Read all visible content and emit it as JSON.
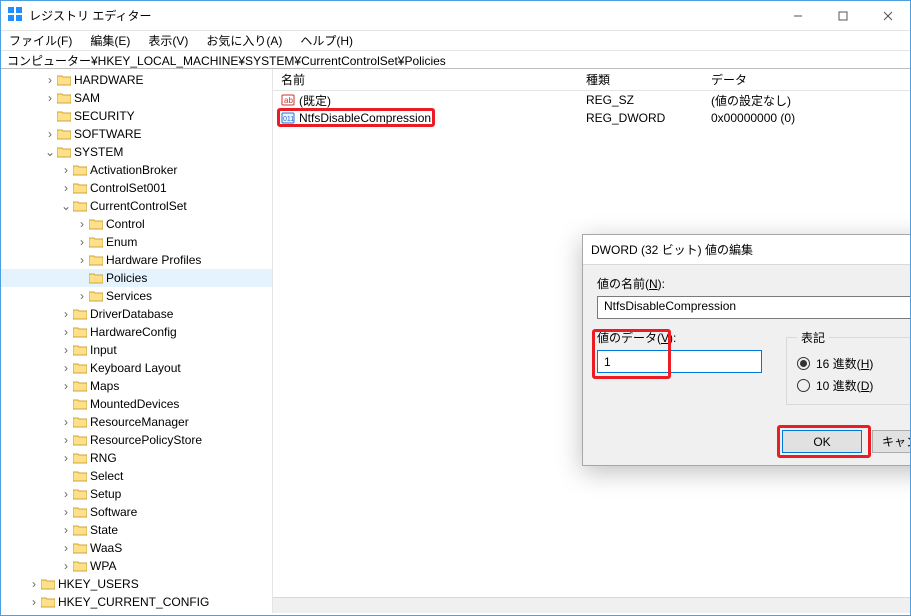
{
  "window": {
    "title": "レジストリ エディター"
  },
  "menu": {
    "file": "ファイル(F)",
    "edit": "編集(E)",
    "view": "表示(V)",
    "favorites": "お気に入り(A)",
    "help": "ヘルプ(H)"
  },
  "address": "コンピューター¥HKEY_LOCAL_MACHINE¥SYSTEM¥CurrentControlSet¥Policies",
  "tree": {
    "hardware": "HARDWARE",
    "sam": "SAM",
    "security": "SECURITY",
    "software": "SOFTWARE",
    "system": "SYSTEM",
    "activationbroker": "ActivationBroker",
    "controlset001": "ControlSet001",
    "currentcontrolset": "CurrentControlSet",
    "control": "Control",
    "enum": "Enum",
    "hardwareprofiles": "Hardware Profiles",
    "policies": "Policies",
    "services": "Services",
    "driverdatabase": "DriverDatabase",
    "hardwareconfig": "HardwareConfig",
    "input": "Input",
    "keyboardlayout": "Keyboard Layout",
    "maps": "Maps",
    "mounteddevices": "MountedDevices",
    "resourcemanager": "ResourceManager",
    "resourcepolicystore": "ResourcePolicyStore",
    "rng": "RNG",
    "select": "Select",
    "setup": "Setup",
    "softwarelc": "Software",
    "state": "State",
    "waas": "WaaS",
    "wpa": "WPA",
    "hkeyusers": "HKEY_USERS",
    "hkeycurrentconfig": "HKEY_CURRENT_CONFIG"
  },
  "columns": {
    "name": "名前",
    "type": "種類",
    "data": "データ"
  },
  "rows": [
    {
      "name": "(既定)",
      "type": "REG_SZ",
      "data": "(値の設定なし)",
      "kind": "sz"
    },
    {
      "name": "NtfsDisableCompression",
      "type": "REG_DWORD",
      "data": "0x00000000 (0)",
      "kind": "dw"
    }
  ],
  "dialog": {
    "title": "DWORD (32 ビット) 値の編集",
    "name_label_pre": "値の名前(",
    "name_label_u": "N",
    "name_label_post": "):",
    "name_value": "NtfsDisableCompression",
    "data_label_pre": "値のデータ(",
    "data_label_u": "V",
    "data_label_post": "):",
    "data_value": "1",
    "radix_label": "表記",
    "radix_hex_pre": "16 進数(",
    "radix_hex_u": "H",
    "radix_hex_post": ")",
    "radix_dec_pre": "10 進数(",
    "radix_dec_u": "D",
    "radix_dec_post": ")",
    "ok": "OK",
    "cancel": "キャンセル"
  }
}
